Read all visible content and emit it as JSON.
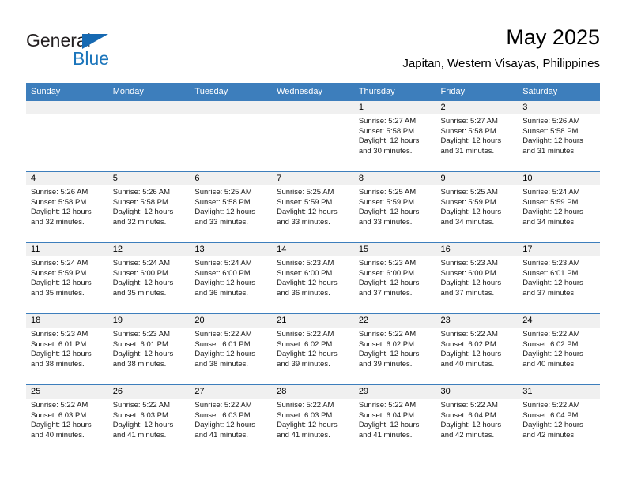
{
  "brand": {
    "name_part1": "General",
    "name_part2": "Blue",
    "color_primary": "#1b75bb",
    "color_dark": "#231f20"
  },
  "header": {
    "title": "May 2025",
    "subtitle": "Japitan, Western Visayas, Philippines"
  },
  "theme": {
    "header_row_bg": "#3d7ebc",
    "daynum_band_bg": "#f0f0f0",
    "cell_bg": "#ffffff",
    "separator": "#3d7ebc"
  },
  "weekday_headers": [
    "Sunday",
    "Monday",
    "Tuesday",
    "Wednesday",
    "Thursday",
    "Friday",
    "Saturday"
  ],
  "weeks": [
    {
      "days": [
        {
          "num": "",
          "sunrise": "",
          "sunset": "",
          "daylight_line1": "",
          "daylight_line2": "",
          "empty": true
        },
        {
          "num": "",
          "sunrise": "",
          "sunset": "",
          "daylight_line1": "",
          "daylight_line2": "",
          "empty": true
        },
        {
          "num": "",
          "sunrise": "",
          "sunset": "",
          "daylight_line1": "",
          "daylight_line2": "",
          "empty": true
        },
        {
          "num": "",
          "sunrise": "",
          "sunset": "",
          "daylight_line1": "",
          "daylight_line2": "",
          "empty": true
        },
        {
          "num": "1",
          "sunrise": "Sunrise: 5:27 AM",
          "sunset": "Sunset: 5:58 PM",
          "daylight_line1": "Daylight: 12 hours",
          "daylight_line2": "and 30 minutes."
        },
        {
          "num": "2",
          "sunrise": "Sunrise: 5:27 AM",
          "sunset": "Sunset: 5:58 PM",
          "daylight_line1": "Daylight: 12 hours",
          "daylight_line2": "and 31 minutes."
        },
        {
          "num": "3",
          "sunrise": "Sunrise: 5:26 AM",
          "sunset": "Sunset: 5:58 PM",
          "daylight_line1": "Daylight: 12 hours",
          "daylight_line2": "and 31 minutes."
        }
      ]
    },
    {
      "days": [
        {
          "num": "4",
          "sunrise": "Sunrise: 5:26 AM",
          "sunset": "Sunset: 5:58 PM",
          "daylight_line1": "Daylight: 12 hours",
          "daylight_line2": "and 32 minutes."
        },
        {
          "num": "5",
          "sunrise": "Sunrise: 5:26 AM",
          "sunset": "Sunset: 5:58 PM",
          "daylight_line1": "Daylight: 12 hours",
          "daylight_line2": "and 32 minutes."
        },
        {
          "num": "6",
          "sunrise": "Sunrise: 5:25 AM",
          "sunset": "Sunset: 5:58 PM",
          "daylight_line1": "Daylight: 12 hours",
          "daylight_line2": "and 33 minutes."
        },
        {
          "num": "7",
          "sunrise": "Sunrise: 5:25 AM",
          "sunset": "Sunset: 5:59 PM",
          "daylight_line1": "Daylight: 12 hours",
          "daylight_line2": "and 33 minutes."
        },
        {
          "num": "8",
          "sunrise": "Sunrise: 5:25 AM",
          "sunset": "Sunset: 5:59 PM",
          "daylight_line1": "Daylight: 12 hours",
          "daylight_line2": "and 33 minutes."
        },
        {
          "num": "9",
          "sunrise": "Sunrise: 5:25 AM",
          "sunset": "Sunset: 5:59 PM",
          "daylight_line1": "Daylight: 12 hours",
          "daylight_line2": "and 34 minutes."
        },
        {
          "num": "10",
          "sunrise": "Sunrise: 5:24 AM",
          "sunset": "Sunset: 5:59 PM",
          "daylight_line1": "Daylight: 12 hours",
          "daylight_line2": "and 34 minutes."
        }
      ]
    },
    {
      "days": [
        {
          "num": "11",
          "sunrise": "Sunrise: 5:24 AM",
          "sunset": "Sunset: 5:59 PM",
          "daylight_line1": "Daylight: 12 hours",
          "daylight_line2": "and 35 minutes."
        },
        {
          "num": "12",
          "sunrise": "Sunrise: 5:24 AM",
          "sunset": "Sunset: 6:00 PM",
          "daylight_line1": "Daylight: 12 hours",
          "daylight_line2": "and 35 minutes."
        },
        {
          "num": "13",
          "sunrise": "Sunrise: 5:24 AM",
          "sunset": "Sunset: 6:00 PM",
          "daylight_line1": "Daylight: 12 hours",
          "daylight_line2": "and 36 minutes."
        },
        {
          "num": "14",
          "sunrise": "Sunrise: 5:23 AM",
          "sunset": "Sunset: 6:00 PM",
          "daylight_line1": "Daylight: 12 hours",
          "daylight_line2": "and 36 minutes."
        },
        {
          "num": "15",
          "sunrise": "Sunrise: 5:23 AM",
          "sunset": "Sunset: 6:00 PM",
          "daylight_line1": "Daylight: 12 hours",
          "daylight_line2": "and 37 minutes."
        },
        {
          "num": "16",
          "sunrise": "Sunrise: 5:23 AM",
          "sunset": "Sunset: 6:00 PM",
          "daylight_line1": "Daylight: 12 hours",
          "daylight_line2": "and 37 minutes."
        },
        {
          "num": "17",
          "sunrise": "Sunrise: 5:23 AM",
          "sunset": "Sunset: 6:01 PM",
          "daylight_line1": "Daylight: 12 hours",
          "daylight_line2": "and 37 minutes."
        }
      ]
    },
    {
      "days": [
        {
          "num": "18",
          "sunrise": "Sunrise: 5:23 AM",
          "sunset": "Sunset: 6:01 PM",
          "daylight_line1": "Daylight: 12 hours",
          "daylight_line2": "and 38 minutes."
        },
        {
          "num": "19",
          "sunrise": "Sunrise: 5:23 AM",
          "sunset": "Sunset: 6:01 PM",
          "daylight_line1": "Daylight: 12 hours",
          "daylight_line2": "and 38 minutes."
        },
        {
          "num": "20",
          "sunrise": "Sunrise: 5:22 AM",
          "sunset": "Sunset: 6:01 PM",
          "daylight_line1": "Daylight: 12 hours",
          "daylight_line2": "and 38 minutes."
        },
        {
          "num": "21",
          "sunrise": "Sunrise: 5:22 AM",
          "sunset": "Sunset: 6:02 PM",
          "daylight_line1": "Daylight: 12 hours",
          "daylight_line2": "and 39 minutes."
        },
        {
          "num": "22",
          "sunrise": "Sunrise: 5:22 AM",
          "sunset": "Sunset: 6:02 PM",
          "daylight_line1": "Daylight: 12 hours",
          "daylight_line2": "and 39 minutes."
        },
        {
          "num": "23",
          "sunrise": "Sunrise: 5:22 AM",
          "sunset": "Sunset: 6:02 PM",
          "daylight_line1": "Daylight: 12 hours",
          "daylight_line2": "and 40 minutes."
        },
        {
          "num": "24",
          "sunrise": "Sunrise: 5:22 AM",
          "sunset": "Sunset: 6:02 PM",
          "daylight_line1": "Daylight: 12 hours",
          "daylight_line2": "and 40 minutes."
        }
      ]
    },
    {
      "days": [
        {
          "num": "25",
          "sunrise": "Sunrise: 5:22 AM",
          "sunset": "Sunset: 6:03 PM",
          "daylight_line1": "Daylight: 12 hours",
          "daylight_line2": "and 40 minutes."
        },
        {
          "num": "26",
          "sunrise": "Sunrise: 5:22 AM",
          "sunset": "Sunset: 6:03 PM",
          "daylight_line1": "Daylight: 12 hours",
          "daylight_line2": "and 41 minutes."
        },
        {
          "num": "27",
          "sunrise": "Sunrise: 5:22 AM",
          "sunset": "Sunset: 6:03 PM",
          "daylight_line1": "Daylight: 12 hours",
          "daylight_line2": "and 41 minutes."
        },
        {
          "num": "28",
          "sunrise": "Sunrise: 5:22 AM",
          "sunset": "Sunset: 6:03 PM",
          "daylight_line1": "Daylight: 12 hours",
          "daylight_line2": "and 41 minutes."
        },
        {
          "num": "29",
          "sunrise": "Sunrise: 5:22 AM",
          "sunset": "Sunset: 6:04 PM",
          "daylight_line1": "Daylight: 12 hours",
          "daylight_line2": "and 41 minutes."
        },
        {
          "num": "30",
          "sunrise": "Sunrise: 5:22 AM",
          "sunset": "Sunset: 6:04 PM",
          "daylight_line1": "Daylight: 12 hours",
          "daylight_line2": "and 42 minutes."
        },
        {
          "num": "31",
          "sunrise": "Sunrise: 5:22 AM",
          "sunset": "Sunset: 6:04 PM",
          "daylight_line1": "Daylight: 12 hours",
          "daylight_line2": "and 42 minutes."
        }
      ]
    }
  ]
}
